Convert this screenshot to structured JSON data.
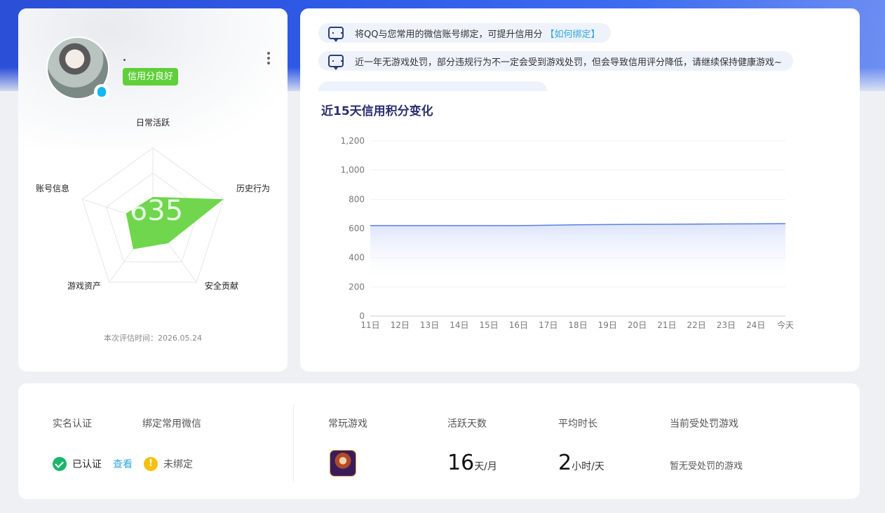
{
  "theme": {
    "accent": "#2f5be8",
    "good": "#5fcf3a",
    "link": "#2fa8e0",
    "line": "#5b7fe0"
  },
  "profile": {
    "nickname": "·",
    "credit_status": "信用分良好",
    "score": "635",
    "radar_labels": [
      "日常活跃",
      "历史行为",
      "安全贡献",
      "游戏资产",
      "账号信息"
    ],
    "eval_time_label": "本次评估时间：",
    "eval_time": "2026.05.24"
  },
  "notices": [
    {
      "text": "将QQ与您常用的微信账号绑定，可提升信用分",
      "link": "【如何绑定】"
    },
    {
      "text": "近一年无游戏处罚，部分违规行为不一定会受到游戏处罚，但会导致信用评分降低，请继续保持健康游戏~",
      "link": ""
    }
  ],
  "chart_title": "近15天信用积分变化",
  "chart_data": {
    "type": "area",
    "title": "近15天信用积分变化",
    "categories": [
      "11日",
      "12日",
      "13日",
      "14日",
      "15日",
      "16日",
      "17日",
      "18日",
      "19日",
      "20日",
      "21日",
      "22日",
      "23日",
      "24日",
      "今天"
    ],
    "values": [
      620,
      620,
      620,
      620,
      620,
      620,
      622,
      625,
      627,
      628,
      629,
      630,
      631,
      632,
      633
    ],
    "y_ticks": [
      "0",
      "200",
      "400",
      "600",
      "800",
      "1,000",
      "1,200"
    ],
    "ylim": [
      0,
      1200
    ],
    "grid": true
  },
  "stats": {
    "realname_label": "实名认证",
    "wechat_label": "绑定常用微信",
    "realname_status": "已认证",
    "view_label": "查看",
    "wechat_status": "未绑定",
    "warn_glyph": "!",
    "game_label": "常玩游戏",
    "game_icon": "game-icon",
    "active_label": "活跃天数",
    "active_value": "16",
    "active_unit": "天/月",
    "duration_label": "平均时长",
    "duration_value": "2",
    "duration_unit": "小时/天",
    "penalty_label": "当前受处罚游戏",
    "penalty_value": "暂无受处罚的游戏"
  }
}
